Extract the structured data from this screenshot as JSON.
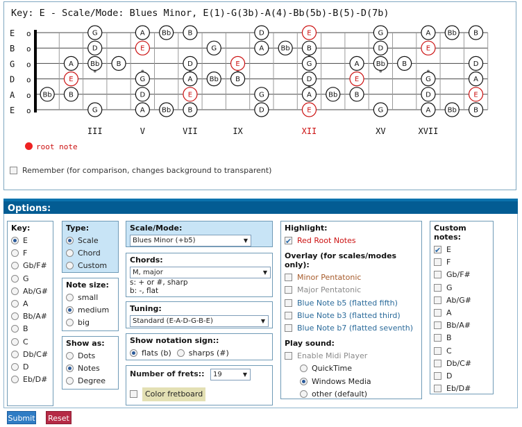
{
  "fretboard": {
    "key_label": "Key: E - Scale/Mode: Blues Minor, E(1)-G(3b)-A(4)-Bb(5b)-B(5)-D(7b)",
    "strings": [
      "E",
      "B",
      "G",
      "D",
      "A",
      "E"
    ],
    "string_open_marks": [
      "o",
      "o",
      "o",
      "o",
      "o",
      "o"
    ],
    "fret_markers": [
      {
        "fret": 3,
        "label": "III",
        "root": false
      },
      {
        "fret": 5,
        "label": "V",
        "root": false
      },
      {
        "fret": 7,
        "label": "VII",
        "root": false
      },
      {
        "fret": 9,
        "label": "IX",
        "root": false
      },
      {
        "fret": 12,
        "label": "XII",
        "root": true
      },
      {
        "fret": 15,
        "label": "XV",
        "root": false
      },
      {
        "fret": 17,
        "label": "XVII",
        "root": false
      }
    ],
    "notes": [
      {
        "string": 0,
        "fret": 3,
        "name": "G",
        "root": false
      },
      {
        "string": 0,
        "fret": 5,
        "name": "A",
        "root": false
      },
      {
        "string": 0,
        "fret": 6,
        "name": "Bb",
        "root": false
      },
      {
        "string": 0,
        "fret": 7,
        "name": "B",
        "root": false
      },
      {
        "string": 0,
        "fret": 10,
        "name": "D",
        "root": false
      },
      {
        "string": 0,
        "fret": 12,
        "name": "E",
        "root": true
      },
      {
        "string": 0,
        "fret": 15,
        "name": "G",
        "root": false
      },
      {
        "string": 0,
        "fret": 17,
        "name": "A",
        "root": false
      },
      {
        "string": 0,
        "fret": 18,
        "name": "Bb",
        "root": false
      },
      {
        "string": 0,
        "fret": 19,
        "name": "B",
        "root": false
      },
      {
        "string": 1,
        "fret": 3,
        "name": "D",
        "root": false
      },
      {
        "string": 1,
        "fret": 5,
        "name": "E",
        "root": true
      },
      {
        "string": 1,
        "fret": 8,
        "name": "G",
        "root": false
      },
      {
        "string": 1,
        "fret": 10,
        "name": "A",
        "root": false
      },
      {
        "string": 1,
        "fret": 11,
        "name": "Bb",
        "root": false
      },
      {
        "string": 1,
        "fret": 12,
        "name": "B",
        "root": false
      },
      {
        "string": 1,
        "fret": 15,
        "name": "D",
        "root": false
      },
      {
        "string": 1,
        "fret": 17,
        "name": "E",
        "root": true
      },
      {
        "string": 2,
        "fret": 2,
        "name": "A",
        "root": false
      },
      {
        "string": 2,
        "fret": 3,
        "name": "Bb",
        "root": false
      },
      {
        "string": 2,
        "fret": 4,
        "name": "B",
        "root": false
      },
      {
        "string": 2,
        "fret": 7,
        "name": "D",
        "root": false
      },
      {
        "string": 2,
        "fret": 9,
        "name": "E",
        "root": true
      },
      {
        "string": 2,
        "fret": 12,
        "name": "G",
        "root": false
      },
      {
        "string": 2,
        "fret": 14,
        "name": "A",
        "root": false
      },
      {
        "string": 2,
        "fret": 15,
        "name": "Bb",
        "root": false
      },
      {
        "string": 2,
        "fret": 16,
        "name": "B",
        "root": false
      },
      {
        "string": 2,
        "fret": 19,
        "name": "D",
        "root": false
      },
      {
        "string": 3,
        "fret": 2,
        "name": "E",
        "root": true
      },
      {
        "string": 3,
        "fret": 5,
        "name": "G",
        "root": false
      },
      {
        "string": 3,
        "fret": 7,
        "name": "A",
        "root": false
      },
      {
        "string": 3,
        "fret": 8,
        "name": "Bb",
        "root": false
      },
      {
        "string": 3,
        "fret": 9,
        "name": "B",
        "root": false
      },
      {
        "string": 3,
        "fret": 12,
        "name": "D",
        "root": false
      },
      {
        "string": 3,
        "fret": 14,
        "name": "E",
        "root": true
      },
      {
        "string": 3,
        "fret": 17,
        "name": "G",
        "root": false
      },
      {
        "string": 3,
        "fret": 19,
        "name": "A",
        "root": false
      },
      {
        "string": 4,
        "fret": 1,
        "name": "Bb",
        "root": false
      },
      {
        "string": 4,
        "fret": 2,
        "name": "B",
        "root": false
      },
      {
        "string": 4,
        "fret": 5,
        "name": "D",
        "root": false
      },
      {
        "string": 4,
        "fret": 7,
        "name": "E",
        "root": true
      },
      {
        "string": 4,
        "fret": 10,
        "name": "G",
        "root": false
      },
      {
        "string": 4,
        "fret": 12,
        "name": "A",
        "root": false
      },
      {
        "string": 4,
        "fret": 13,
        "name": "Bb",
        "root": false
      },
      {
        "string": 4,
        "fret": 14,
        "name": "B",
        "root": false
      },
      {
        "string": 4,
        "fret": 17,
        "name": "D",
        "root": false
      },
      {
        "string": 4,
        "fret": 19,
        "name": "E",
        "root": true
      },
      {
        "string": 5,
        "fret": 3,
        "name": "G",
        "root": false
      },
      {
        "string": 5,
        "fret": 5,
        "name": "A",
        "root": false
      },
      {
        "string": 5,
        "fret": 6,
        "name": "Bb",
        "root": false
      },
      {
        "string": 5,
        "fret": 7,
        "name": "B",
        "root": false
      },
      {
        "string": 5,
        "fret": 10,
        "name": "D",
        "root": false
      },
      {
        "string": 5,
        "fret": 12,
        "name": "E",
        "root": true
      },
      {
        "string": 5,
        "fret": 15,
        "name": "G",
        "root": false
      },
      {
        "string": 5,
        "fret": 17,
        "name": "A",
        "root": false
      },
      {
        "string": 5,
        "fret": 18,
        "name": "Bb",
        "root": false
      },
      {
        "string": 5,
        "fret": 19,
        "name": "B",
        "root": false
      }
    ],
    "root_legend": "root note",
    "remember_label": "Remember (for comparison, changes background to transparent)",
    "remember_checked": false,
    "colors": {
      "root": "#cc1111",
      "note_border": "#111111",
      "dot": "#666666"
    }
  },
  "options": {
    "header": "Options:",
    "key": {
      "title": "Key:",
      "items": [
        "E",
        "F",
        "Gb/F#",
        "G",
        "Ab/G#",
        "A",
        "Bb/A#",
        "B",
        "C",
        "Db/C#",
        "D",
        "Eb/D#"
      ],
      "selected": "E"
    },
    "type": {
      "title": "Type:",
      "items": [
        "Scale",
        "Chord",
        "Custom"
      ],
      "selected": "Scale"
    },
    "note_size": {
      "title": "Note size:",
      "items": [
        "small",
        "medium",
        "big"
      ],
      "selected": "medium"
    },
    "show_as": {
      "title": "Show as:",
      "items": [
        "Dots",
        "Notes",
        "Degree"
      ],
      "selected": "Notes"
    },
    "scale_mode": {
      "title": "Scale/Mode:",
      "value": "Blues Minor (+b5)"
    },
    "chords": {
      "title": "Chords:",
      "value": "M, major",
      "hint1": "s: + or #, sharp",
      "hint2": "b: -, flat"
    },
    "tuning": {
      "title": "Tuning:",
      "value": "Standard (E-A-D-G-B-E)"
    },
    "notation": {
      "title": "Show notation sign::",
      "items": [
        "flats (b)",
        "sharps (#)"
      ],
      "selected": "flats (b)"
    },
    "frets": {
      "title": "Number of frets::",
      "value": "19",
      "color_label": "Color fretboard",
      "color_checked": false
    },
    "highlight": {
      "title": "Highlight:",
      "red_root": {
        "label": "Red Root Notes",
        "checked": true
      },
      "overlay_title": "Overlay (for scales/modes only):",
      "overlays": [
        {
          "label": "Minor Pentatonic",
          "checked": false
        },
        {
          "label": "Major Pentatonic",
          "checked": false
        },
        {
          "label": "Blue Note b5 (flatted fifth)",
          "checked": false
        },
        {
          "label": "Blue Note b3 (flatted third)",
          "checked": false
        },
        {
          "label": "Blue Note b7 (flatted seventh)",
          "checked": false
        }
      ],
      "play_title": "Play sound:",
      "midi": {
        "label": "Enable Midi Player",
        "checked": false
      },
      "players": [
        "QuickTime",
        "Windows Media",
        "other (default)"
      ],
      "player_selected": "Windows Media"
    },
    "custom_notes": {
      "title": "Custom notes:",
      "items": [
        "E",
        "F",
        "Gb/F#",
        "G",
        "Ab/G#",
        "A",
        "Bb/A#",
        "B",
        "C",
        "Db/C#",
        "D",
        "Eb/D#"
      ],
      "checked": [
        "E"
      ]
    },
    "submit_label": "Submit",
    "reset_label": "Reset"
  }
}
